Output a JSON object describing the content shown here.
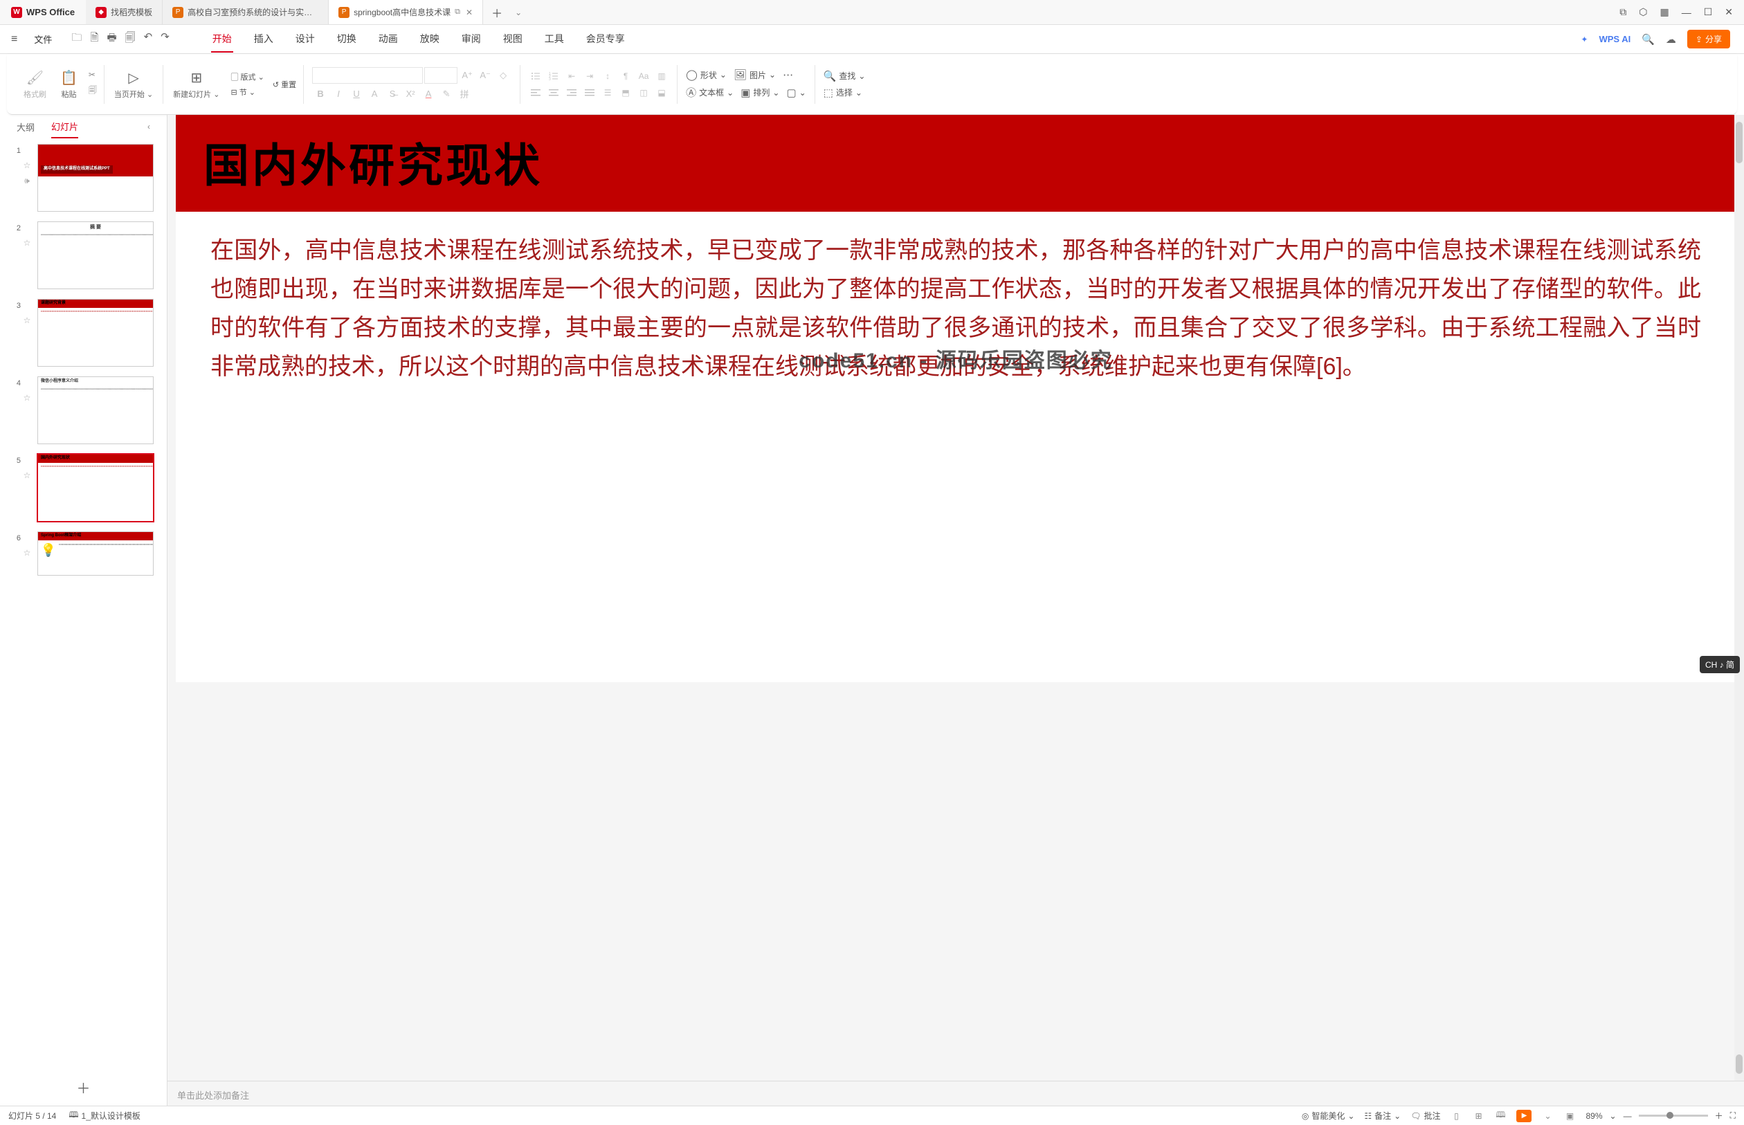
{
  "app": {
    "name": "WPS Office"
  },
  "tabs": [
    {
      "label": "找稻壳模板",
      "icon": "d",
      "active": false
    },
    {
      "label": "高校自习室预约系统的设计与实现.pp",
      "icon": "p",
      "active": false
    },
    {
      "label": "springboot高中信息技术课",
      "icon": "p",
      "active": true
    }
  ],
  "file_label": "文件",
  "menus": [
    "开始",
    "插入",
    "设计",
    "切换",
    "动画",
    "放映",
    "审阅",
    "视图",
    "工具",
    "会员专享"
  ],
  "wpsai": "WPS AI",
  "share": "分享",
  "ribbon": {
    "format_painter": "格式刷",
    "paste": "粘贴",
    "from_current": "当页开始",
    "new_slide": "新建幻灯片",
    "layout": "版式",
    "section": "节",
    "reset": "重置",
    "shape": "形状",
    "textbox": "文本框",
    "picture": "图片",
    "arrange": "排列",
    "find": "查找",
    "select": "选择"
  },
  "side": {
    "outline": "大纲",
    "slides": "幻灯片"
  },
  "thumbs": [
    {
      "n": "1",
      "title": "高中信息技术课程在线测试系统PPT"
    },
    {
      "n": "2",
      "title": "摘 要"
    },
    {
      "n": "3",
      "title": "课题研究背景"
    },
    {
      "n": "4",
      "title": "微信小程序意义介绍"
    },
    {
      "n": "5",
      "title": "国内外研究现状"
    },
    {
      "n": "6",
      "title": "Spring Boot框架介绍"
    }
  ],
  "slide": {
    "title": "国内外研究现状",
    "body": "在国外，高中信息技术课程在线测试系统技术，早已变成了一款非常成熟的技术，那各种各样的针对广大用户的高中信息技术课程在线测试系统也随即出现，在当时来讲数据库是一个很大的问题，因此为了整体的提高工作状态，当时的开发者又根据具体的情况开发出了存储型的软件。此时的软件有了各方面技术的支撑，其中最主要的一点就是该软件借助了很多通讯的技术，而且集合了交叉了很多学科。由于系统工程融入了当时非常成熟的技术，所以这个时期的高中信息技术课程在线测试系统都更加的安全，系统维护起来也更有保障[6]。"
  },
  "watermark": "code51.cn - 源码乐园盗图必究",
  "notes_placeholder": "单击此处添加备注",
  "ime": "CH ♪ 简",
  "status": {
    "slide_pos": "幻灯片 5 / 14",
    "template": "1_默认设计模板",
    "beautify": "智能美化",
    "notes": "备注",
    "comments": "批注",
    "zoom": "89%"
  }
}
